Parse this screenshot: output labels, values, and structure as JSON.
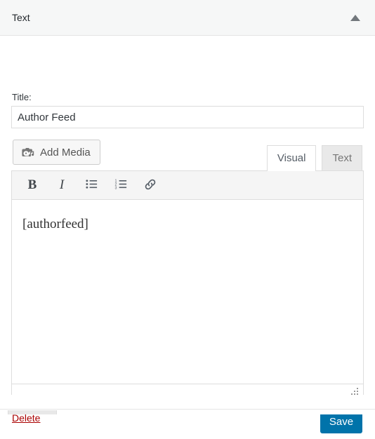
{
  "widget": {
    "header": {
      "title": "Text",
      "toggle_icon": "chevron-up-icon"
    },
    "title_field": {
      "label": "Title:",
      "value": "Author Feed",
      "placeholder": ""
    },
    "add_media": {
      "label": "Add Media",
      "icon": "media-camera-music-icon"
    },
    "editor": {
      "tabs": [
        {
          "label": "Visual",
          "active": true
        },
        {
          "label": "Text",
          "active": false
        }
      ],
      "toolbar": [
        {
          "name": "bold-button",
          "glyph": "B"
        },
        {
          "name": "italic-button",
          "glyph": "I"
        },
        {
          "name": "bulleted-list-button",
          "glyph": "unordered-list-icon"
        },
        {
          "name": "numbered-list-button",
          "glyph": "ordered-list-icon"
        },
        {
          "name": "insert-link-button",
          "glyph": "link-icon"
        }
      ],
      "content": "[authorfeed]",
      "resize_handle_icon": "resize-grip-icon"
    },
    "footer": {
      "delete_label": "Delete",
      "save_label": "Save"
    }
  },
  "colors": {
    "accent_blue": "#0073aa",
    "delete_red": "#a00",
    "header_bg": "#f6f7f7",
    "toolbar_bg": "#f5f5f5",
    "border": "#ddd"
  }
}
